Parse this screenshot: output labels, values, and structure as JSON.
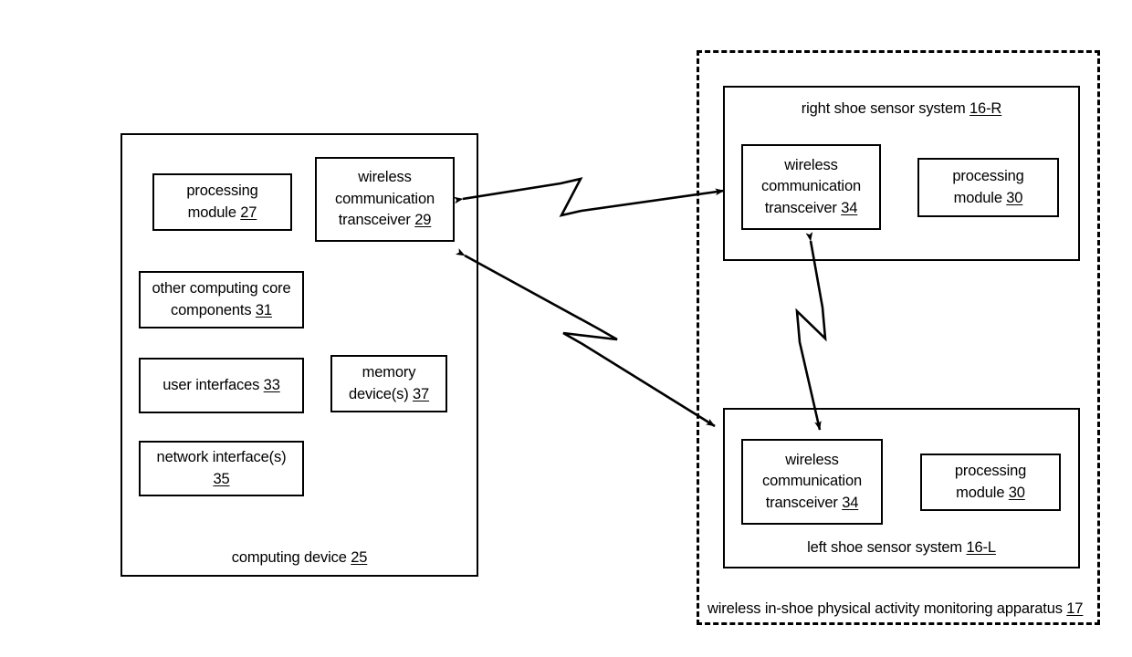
{
  "figure": {
    "type": "patent-block-diagram",
    "background": "#ffffff",
    "stroke": "#000000"
  },
  "computing_device": {
    "caption_text": "computing device ",
    "caption_ref": "25",
    "blocks": [
      {
        "text": "processing\nmodule ",
        "ref": "27",
        "name": "processing-module-27"
      },
      {
        "text": "wireless\ncommunication\ntransceiver ",
        "ref": "29",
        "name": "wireless-communication-transceiver-29"
      },
      {
        "text": "other computing core\ncomponents ",
        "ref": "31",
        "name": "other-computing-core-components-31"
      },
      {
        "text": "user interfaces ",
        "ref": "33",
        "name": "user-interfaces-33"
      },
      {
        "text": "memory\ndevice(s) ",
        "ref": "37",
        "name": "memory-devices-37"
      },
      {
        "text": "network interface(s)\n",
        "ref": "35",
        "name": "network-interfaces-35"
      }
    ]
  },
  "apparatus": {
    "caption_text": "wireless in-shoe physical activity monitoring apparatus ",
    "caption_ref": "17"
  },
  "right_shoe": {
    "caption_text": "right shoe sensor system ",
    "caption_ref": "16-R",
    "transceiver_text": "wireless\ncommunication\ntransceiver ",
    "transceiver_ref": "34",
    "processing_text": "processing\nmodule ",
    "processing_ref": "30"
  },
  "left_shoe": {
    "caption_text": "left shoe sensor system ",
    "caption_ref": "16-L",
    "transceiver_text": "wireless\ncommunication\ntransceiver ",
    "transceiver_ref": "34",
    "processing_text": "processing\nmodule ",
    "processing_ref": "30"
  },
  "connectors": [
    {
      "name": "wireless-link-right",
      "style": "double-headed-zigzag-arrow",
      "from": "wireless communication transceiver 29",
      "to": "right shoe wireless communication transceiver 34"
    },
    {
      "name": "wireless-link-left",
      "style": "double-headed-zigzag-arrow",
      "from": "wireless communication transceiver 29",
      "to": "left shoe sensor system 16-L"
    },
    {
      "name": "wireless-link-shoe-to-shoe",
      "style": "double-headed-zigzag-arrow",
      "from": "left shoe wireless communication transceiver 34",
      "to": "right shoe wireless communication transceiver 34"
    }
  ]
}
